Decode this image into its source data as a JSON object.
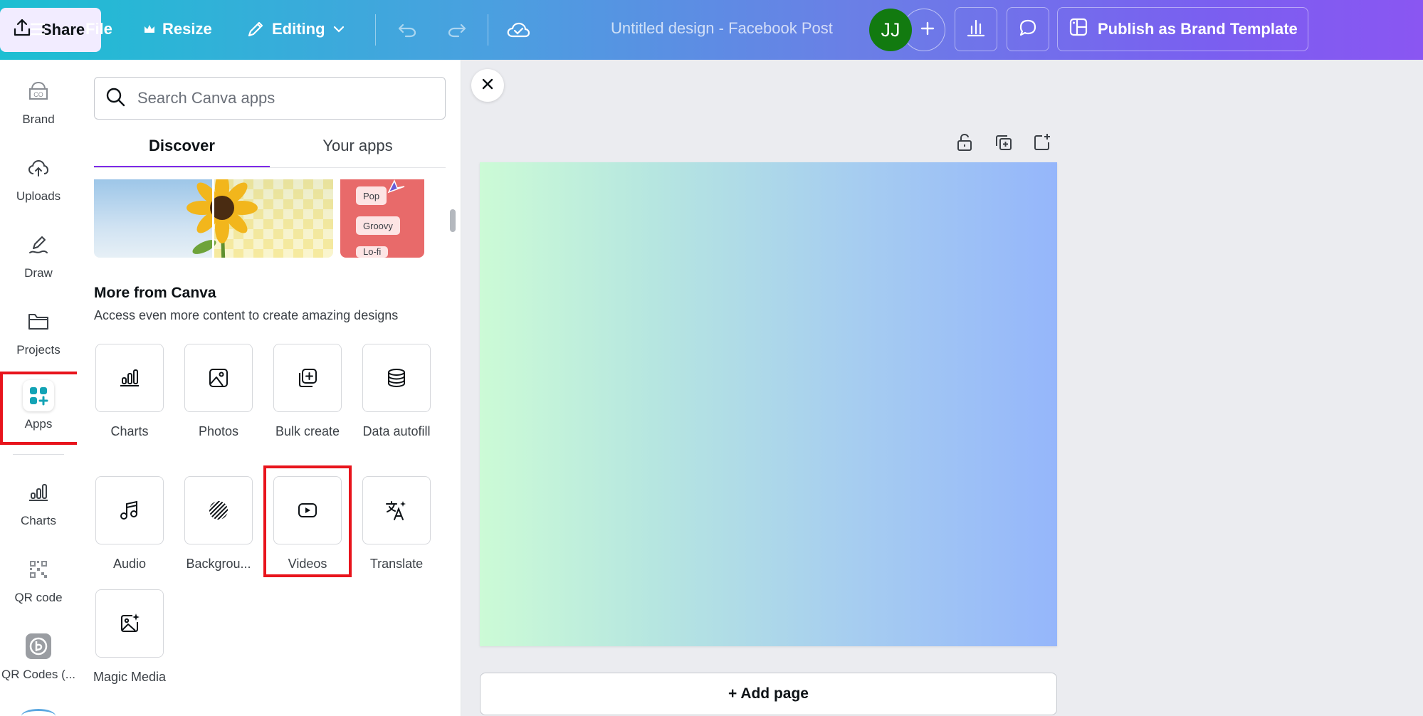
{
  "topbar": {
    "file": "File",
    "resize": "Resize",
    "editing": "Editing",
    "title": "Untitled design - Facebook Post",
    "avatar": "JJ",
    "publish": "Publish as Brand Template",
    "share": "Share"
  },
  "rail": {
    "brand": "Brand",
    "uploads": "Uploads",
    "draw": "Draw",
    "projects": "Projects",
    "apps": "Apps",
    "charts": "Charts",
    "qrcode": "QR code",
    "qrcodes2": "QR Codes (..."
  },
  "panel": {
    "search_placeholder": "Search Canva apps",
    "tab_discover": "Discover",
    "tab_your_apps": "Your apps",
    "banner_chips": [
      "Pop",
      "Groovy",
      "Lo-fi"
    ],
    "section_title": "More from Canva",
    "section_subtitle": "Access even more content to create amazing designs",
    "apps": [
      {
        "label": "Charts",
        "icon": "bar-chart-icon"
      },
      {
        "label": "Photos",
        "icon": "image-icon"
      },
      {
        "label": "Bulk create",
        "icon": "bulk-create-icon"
      },
      {
        "label": "Data autofill",
        "icon": "database-icon"
      },
      {
        "label": "Audio",
        "icon": "music-note-icon"
      },
      {
        "label": "Backgrou...",
        "icon": "background-pattern-icon"
      },
      {
        "label": "Videos",
        "icon": "play-video-icon"
      },
      {
        "label": "Translate",
        "icon": "translate-icon"
      },
      {
        "label": "Magic Media",
        "icon": "magic-media-icon"
      }
    ]
  },
  "canvas": {
    "add_page": "+ Add page"
  },
  "colors": {
    "highlight": "#e8141c",
    "accent": "#7d2ae8",
    "avatar_bg": "#127a10"
  }
}
